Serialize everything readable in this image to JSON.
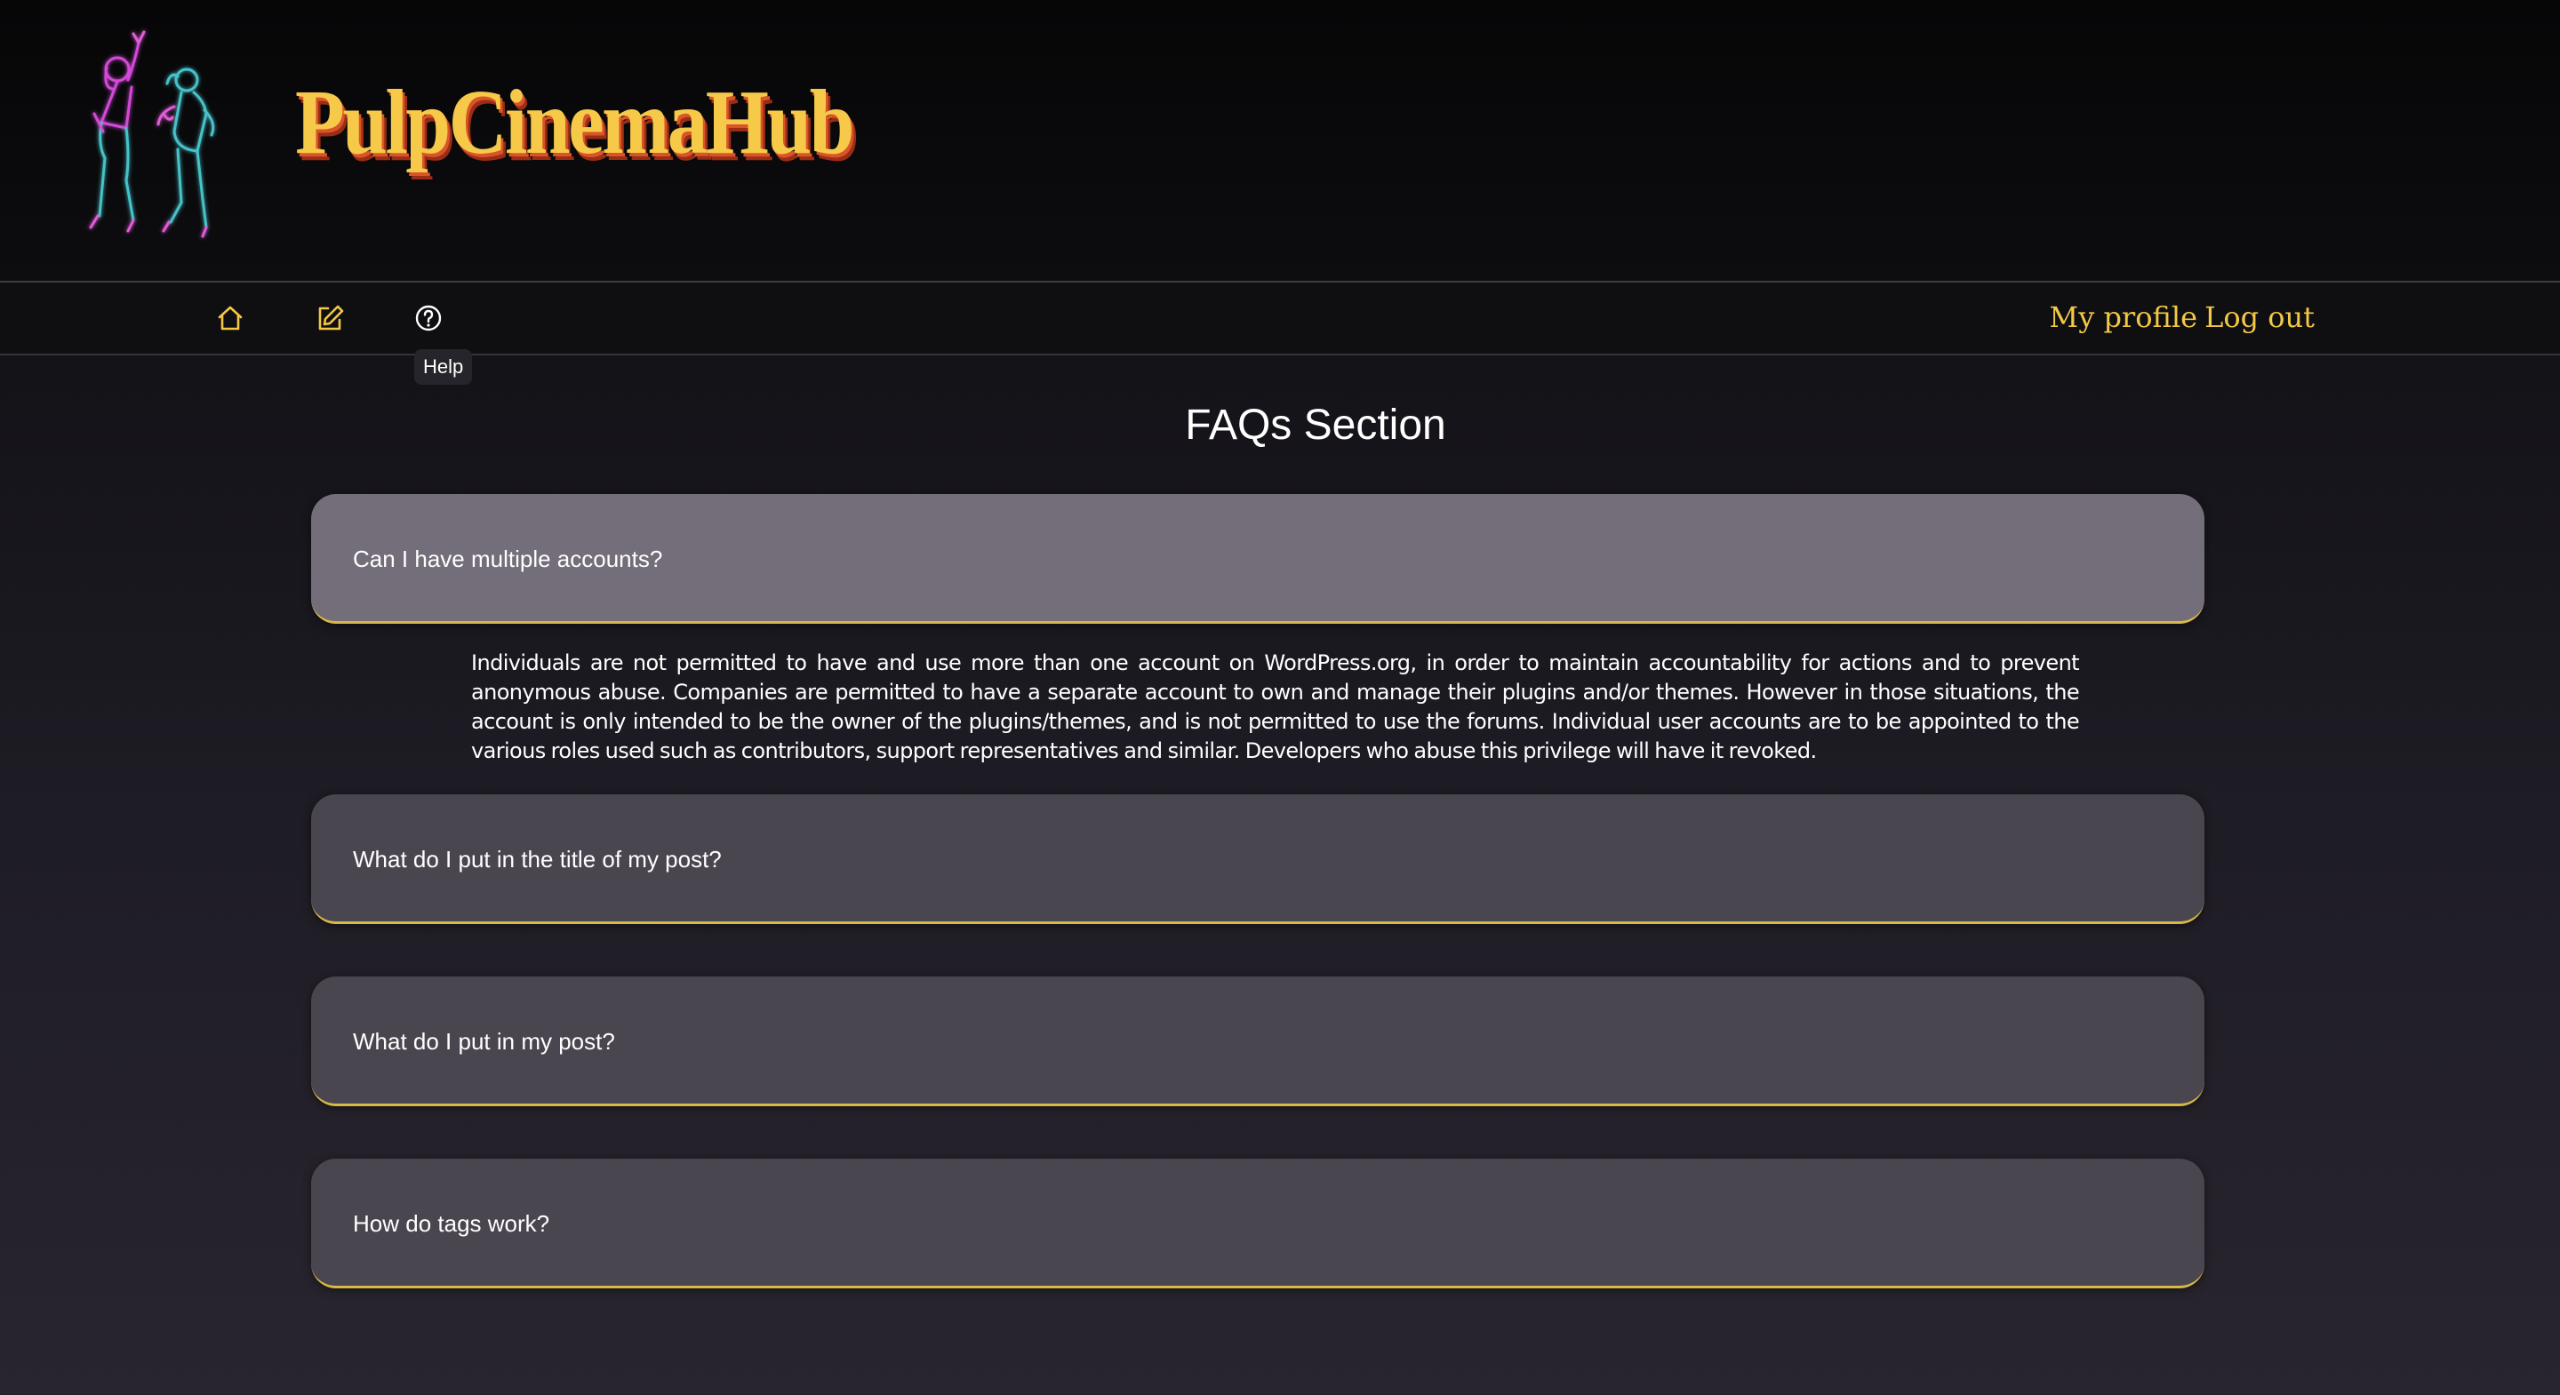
{
  "brand": {
    "name": "PulpCinemaHub",
    "logo_icon": "dancing-couple-neon-icon"
  },
  "nav": {
    "icons": [
      "home-icon",
      "edit-icon",
      "help-icon"
    ],
    "tooltip": "Help",
    "profile_label": "My profile",
    "logout_label": "Log out"
  },
  "page": {
    "title": "FAQs Section"
  },
  "faqs": [
    {
      "question": "Can I have multiple accounts?",
      "expanded": true,
      "answer": "Individuals are not permitted to have and use more than one account on WordPress.org, in order to maintain accountability for actions and to prevent anonymous abuse. Companies are permitted to have a separate account to own and manage their plugins and/or themes. However in those situations, the account is only intended to be the owner of the plugins/themes, and is not permitted to use the forums. Individual user accounts are to be appointed to the various roles used such as contributors, support representatives and similar. Developers who abuse this privilege will have it revoked."
    },
    {
      "question": "What do I put in the title of my post?",
      "expanded": false
    },
    {
      "question": "What do I put in my post?",
      "expanded": false
    },
    {
      "question": "How do tags work?",
      "expanded": false
    }
  ],
  "colors": {
    "accent": "#f3c845",
    "card": "#4a4650",
    "card_active": "#736e79",
    "card_border": "#d8b846",
    "background_top": "#060607",
    "background_bottom": "#29252f"
  }
}
